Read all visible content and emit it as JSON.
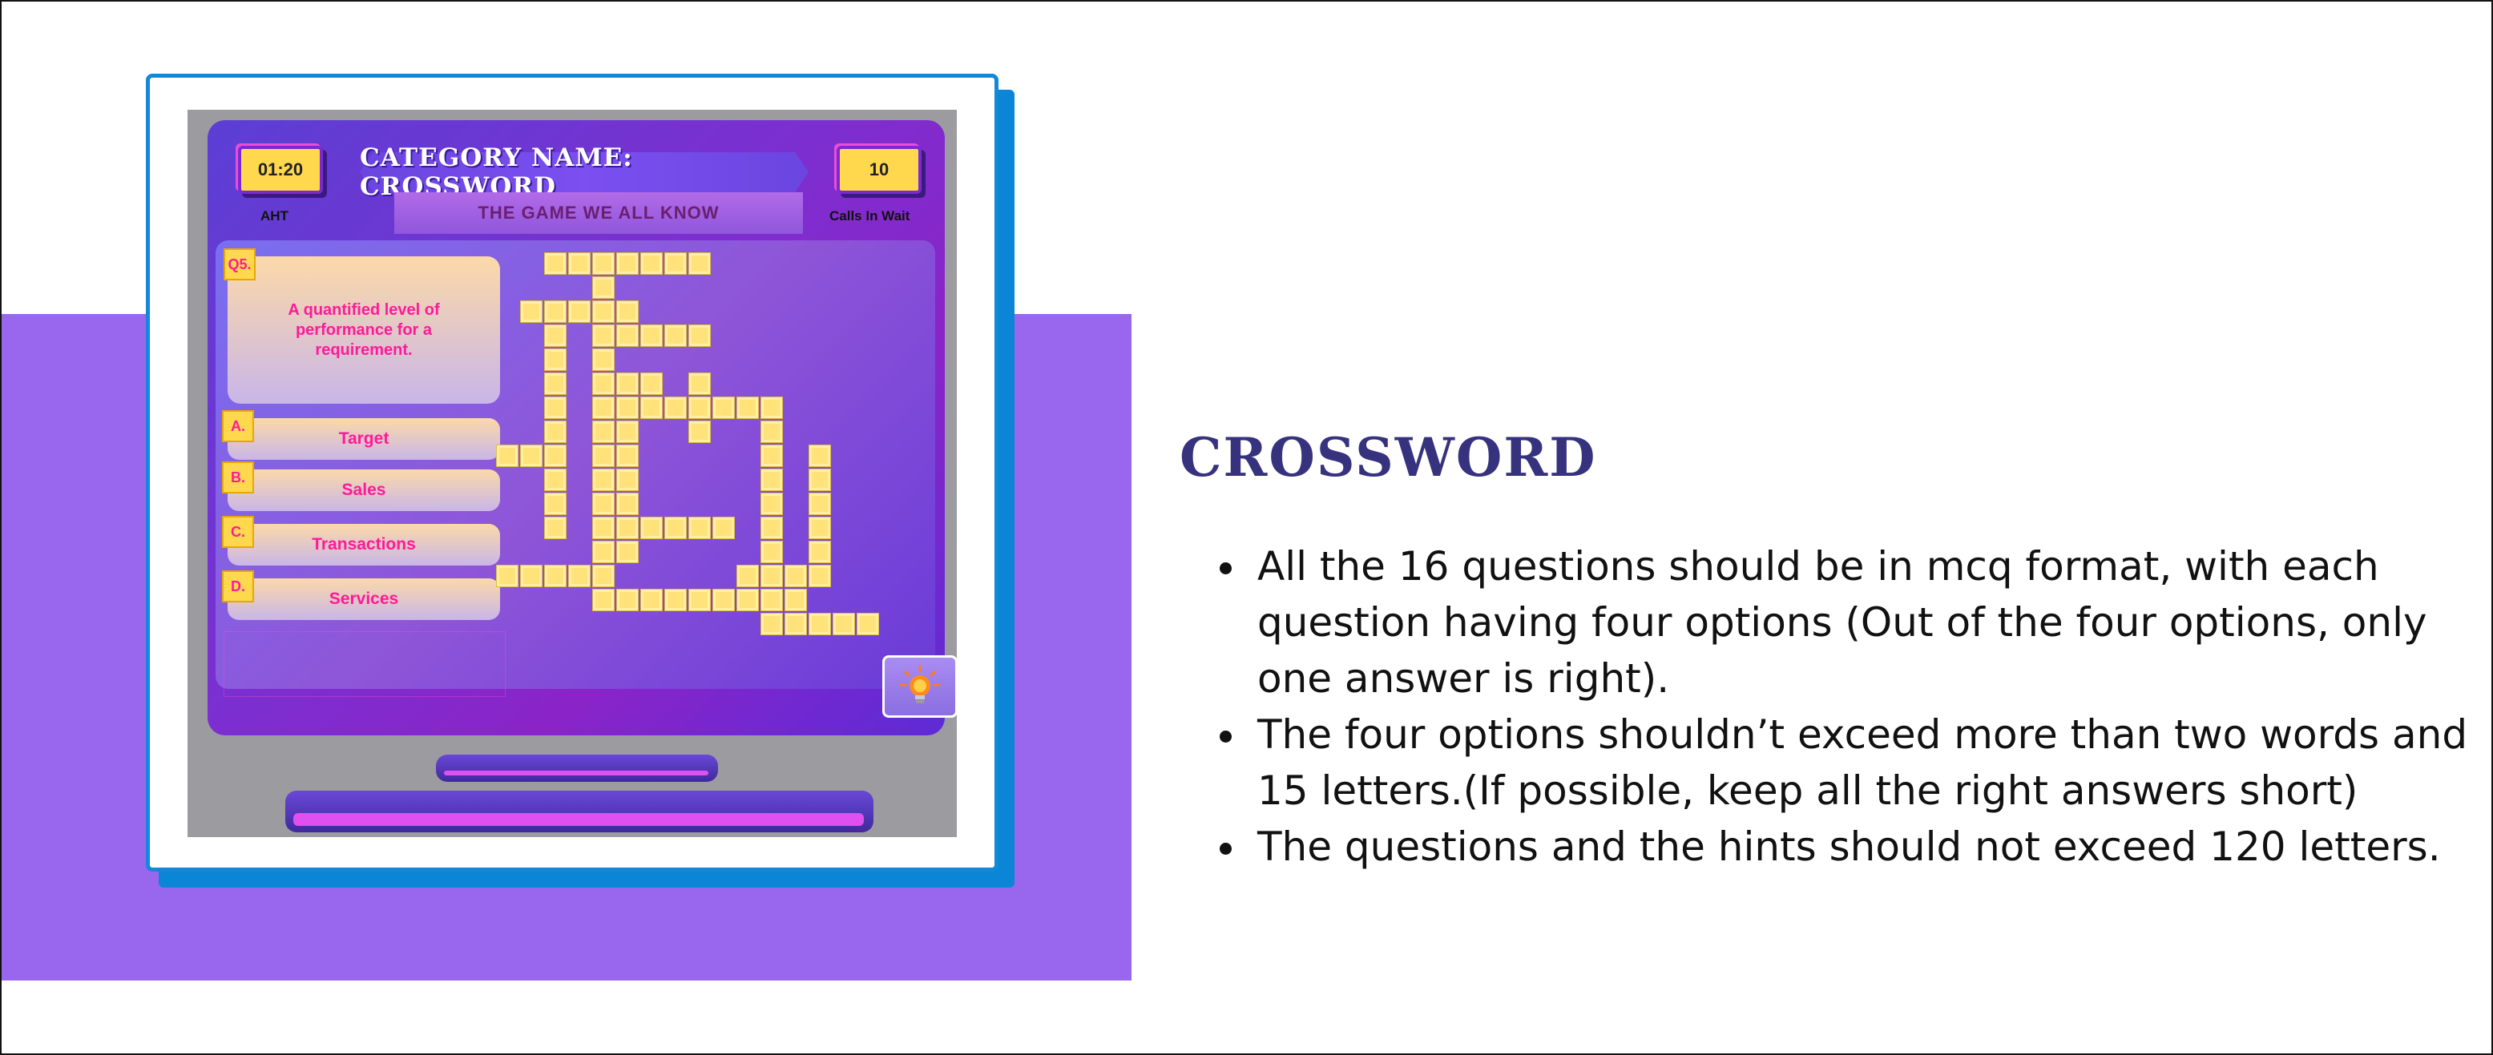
{
  "game": {
    "timer": "01:20",
    "timer_label": "AHT",
    "calls_value": "10",
    "calls_label": "Calls In Wait",
    "category_title": "CATEGORY NAME: CROSSWORD",
    "subtitle": "THE GAME WE ALL KNOW",
    "question_number": "Q5.",
    "question_text": "A quantified level of performance for a requirement.",
    "options": [
      {
        "letter": "A.",
        "label": "Target"
      },
      {
        "letter": "B.",
        "label": "Sales"
      },
      {
        "letter": "C.",
        "label": "Transactions"
      },
      {
        "letter": "D.",
        "label": "Services"
      }
    ],
    "hint_icon": "lightbulb-icon"
  },
  "description": {
    "heading": "CROSSWORD",
    "bullets": [
      "All the 16 questions should be in mcq format, with each question having four options (Out of the four options, only one answer is right).",
      "The four options shouldn’t exceed more than two words and 15 letters.(If possible, keep all the right answers short)",
      "The questions and the hints should not exceed 120 letters."
    ]
  },
  "colors": {
    "band": "#9966ee",
    "frame": "#1188d8",
    "heading": "#36327e",
    "option_text": "#ff1a9a",
    "cell": "#ffe27a"
  }
}
